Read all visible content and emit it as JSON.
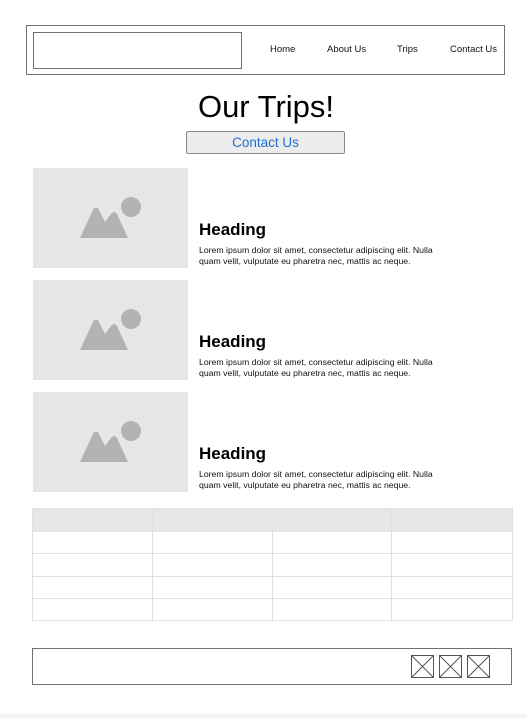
{
  "nav": {
    "items": [
      {
        "label": "Home"
      },
      {
        "label": "About Us"
      },
      {
        "label": "Trips"
      },
      {
        "label": "Contact Us"
      }
    ]
  },
  "main": {
    "title": "Our Trips!",
    "contact_button": "Contact Us",
    "cards": [
      {
        "heading": "Heading",
        "text": "Lorem ipsum dolor sit amet, consectetur adipiscing elit. Nulla quam velit, vulputate eu pharetra nec, mattis ac neque.",
        "image_icon": "image-placeholder-icon"
      },
      {
        "heading": "Heading",
        "text": "Lorem ipsum dolor sit amet, consectetur adipiscing elit. Nulla quam velit, vulputate eu pharetra nec, mattis ac neque.",
        "image_icon": "image-placeholder-icon"
      },
      {
        "heading": "Heading",
        "text": "Lorem ipsum dolor sit amet, consectetur adipiscing elit. Nulla quam velit, vulputate eu pharetra nec, mattis ac neque.",
        "image_icon": "image-placeholder-icon"
      }
    ]
  },
  "footer": {
    "icons": [
      "placeholder-icon",
      "placeholder-icon",
      "placeholder-icon"
    ]
  },
  "colors": {
    "placeholder_bg": "#e6e6e6",
    "placeholder_icon": "#b3b3b3",
    "button_text": "#1f6fd0",
    "border": "#6f6f6f"
  }
}
